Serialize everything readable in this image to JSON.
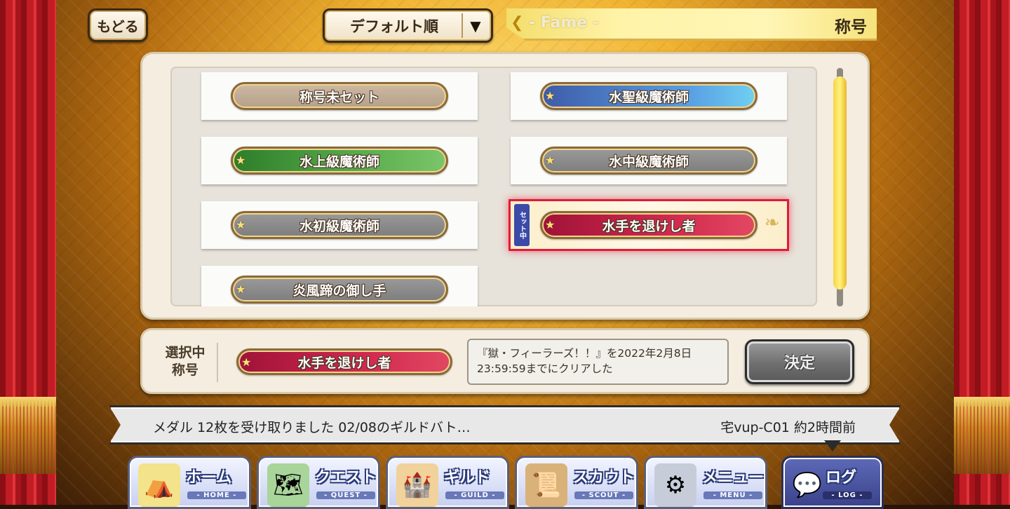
{
  "header": {
    "back_label": "もどる",
    "sort_label": "デフォルト順",
    "fame_en": "- Fame -",
    "fame_jp": "称号"
  },
  "titles": [
    {
      "label": "称号未セット",
      "style": "tan"
    },
    {
      "label": "水聖級魔術師",
      "style": "blue"
    },
    {
      "label": "水上級魔術師",
      "style": "green"
    },
    {
      "label": "水中級魔術師",
      "style": "gray"
    },
    {
      "label": "水初級魔術師",
      "style": "gray"
    },
    {
      "label": "水手を退けし者",
      "style": "crimson",
      "equipped_tag": "セット中"
    },
    {
      "label": "炎風蹄の御し手",
      "style": "gray"
    }
  ],
  "selected": {
    "label": "選択中称号",
    "title": "水手を退けし者",
    "description": "『獄・フィーラーズ！！』を2022年2月8日23:59:59までにクリアした",
    "decide_label": "決定"
  },
  "log": {
    "message": "メダル 12枚を受け取りました 02/08のギルドバト…",
    "meta": "宅vup-C01 約2時間前"
  },
  "nav": [
    {
      "label": "ホーム",
      "sub": "- HOME -",
      "icon": "tent-icon"
    },
    {
      "label": "クエスト",
      "sub": "- QUEST -",
      "icon": "map-icon"
    },
    {
      "label": "ギルド",
      "sub": "- GUILD -",
      "icon": "castle-icon"
    },
    {
      "label": "スカウト",
      "sub": "- SCOUT -",
      "icon": "scroll-icon"
    },
    {
      "label": "メニュー",
      "sub": "- MENU -",
      "icon": "gear-icon"
    },
    {
      "label": "ログ",
      "sub": "- LOG -",
      "icon": "chat-bubble-icon"
    }
  ],
  "colors": {
    "accent_red": "#e01b3a",
    "plate_crimson": "#d2294f",
    "plate_blue": "#5aa0e4",
    "plate_green": "#58ad4c",
    "plate_gray": "#8a8a8a",
    "scroll_yellow": "#f7d44a"
  }
}
